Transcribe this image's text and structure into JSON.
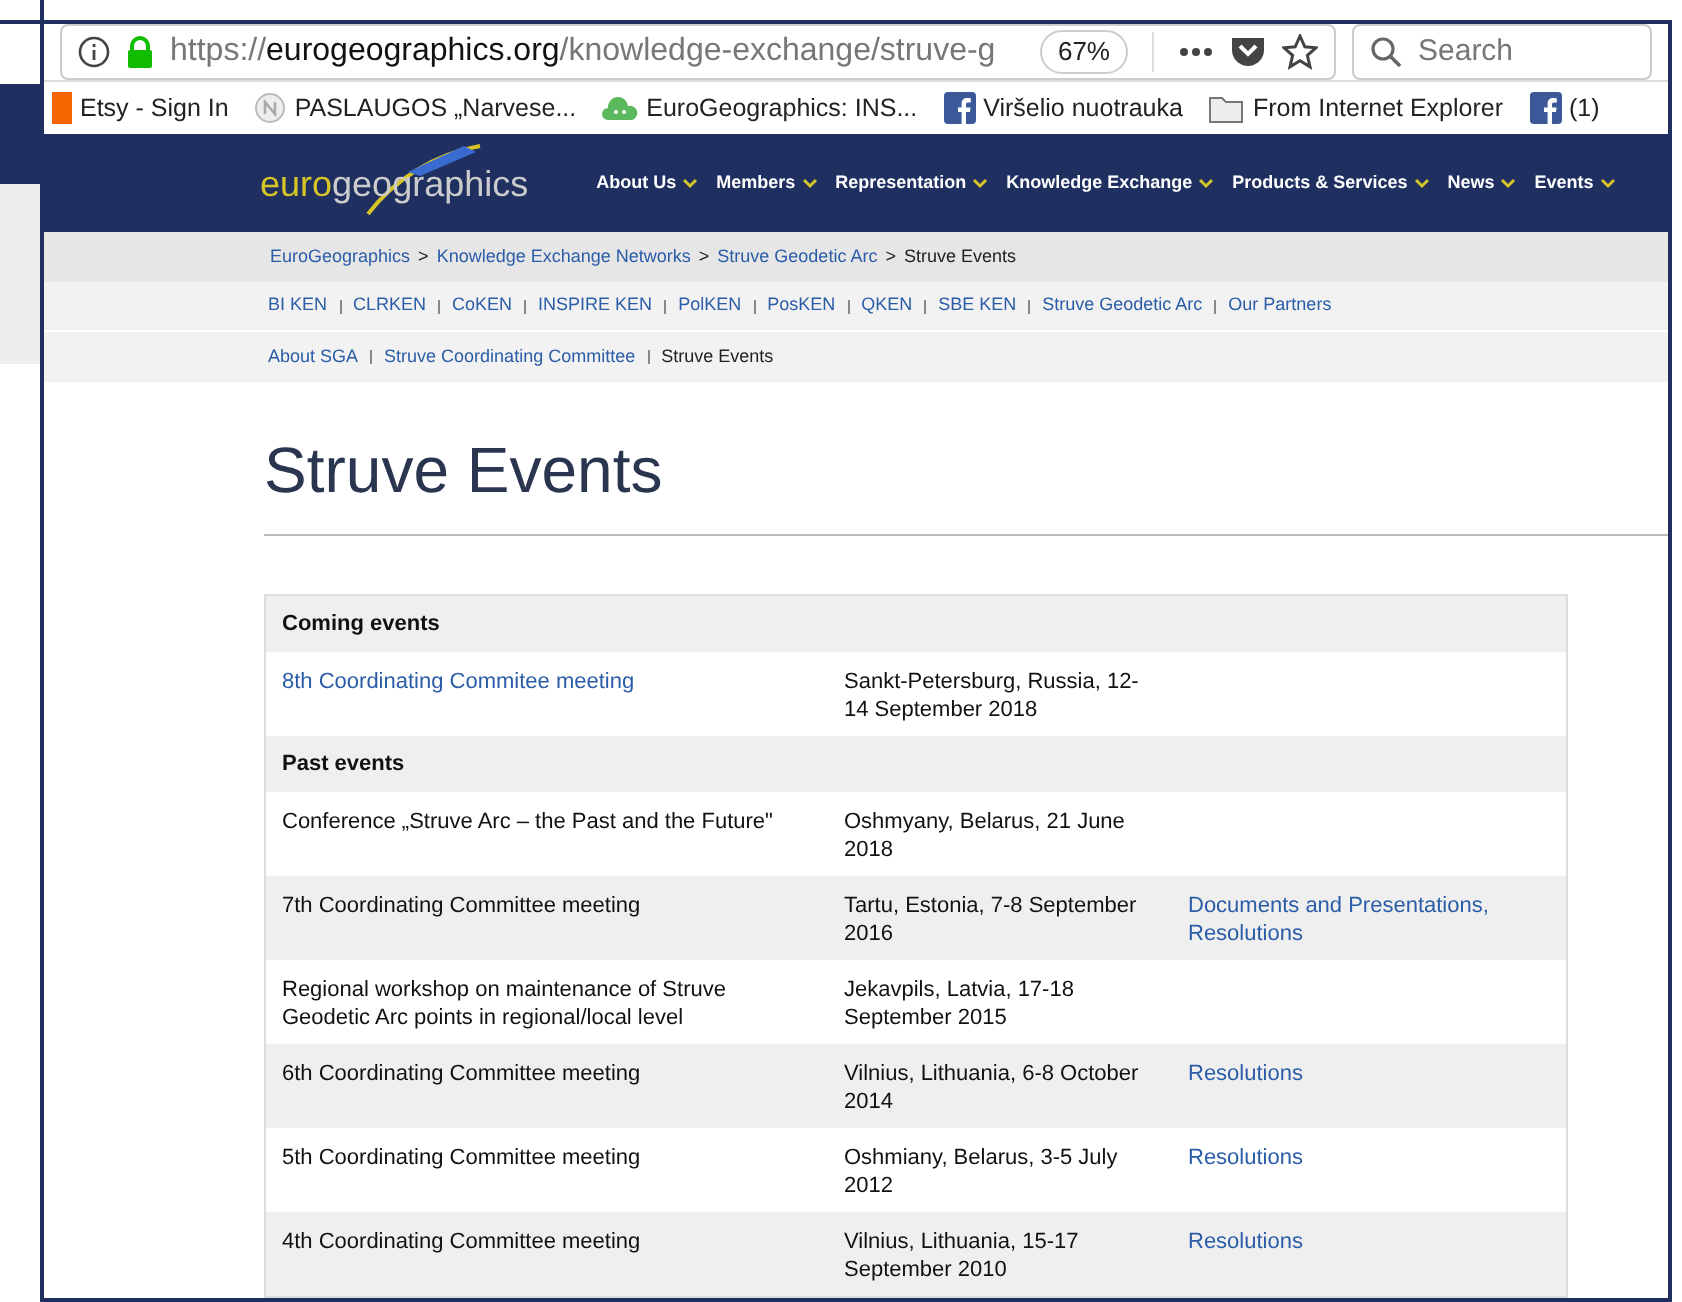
{
  "address_bar": {
    "url_host_prefix": "https://",
    "url_host": "eurogeographics.org",
    "url_path": "/knowledge-exchange/struve-g",
    "zoom": "67%",
    "search_placeholder": "Search"
  },
  "bookmarks": [
    {
      "label": "Etsy - Sign In",
      "kind": "etsy"
    },
    {
      "label": "PASLAUGOS „Narvese...",
      "kind": "circle"
    },
    {
      "label": "EuroGeographics: INS...",
      "kind": "cloud"
    },
    {
      "label": "Viršelio nuotrauka",
      "kind": "facebook"
    },
    {
      "label": "From Internet Explorer",
      "kind": "folder"
    },
    {
      "label": "(1)",
      "kind": "facebook"
    }
  ],
  "site": {
    "logo_prefix": "euro",
    "logo_suffix": "geographics",
    "menu": [
      "About Us",
      "Members",
      "Representation",
      "Knowledge Exchange",
      "Products & Services",
      "News",
      "Events"
    ],
    "breadcrumbs": [
      {
        "label": "EuroGeographics",
        "current": false
      },
      {
        "separator": ">",
        "label": "Knowledge Exchange Networks",
        "current": false
      },
      {
        "separator": ">",
        "label": "Struve Geodetic Arc",
        "current": false
      },
      {
        "separator": ">",
        "label": "Struve Events",
        "current": true
      }
    ],
    "subnav": [
      {
        "label": "BI KEN",
        "selected": false
      },
      {
        "label": "CLRKEN",
        "selected": false
      },
      {
        "label": "CoKEN",
        "selected": false
      },
      {
        "label": "INSPIRE KEN",
        "selected": false
      },
      {
        "label": "PolKEN",
        "selected": false
      },
      {
        "label": "PosKEN",
        "selected": false
      },
      {
        "label": "QKEN",
        "selected": false
      },
      {
        "label": "SBE KEN",
        "selected": false
      },
      {
        "label": "Struve Geodetic Arc",
        "selected": false
      },
      {
        "label": "Our Partners",
        "selected": false
      }
    ],
    "subnav2": [
      {
        "label": "About SGA",
        "selected": false
      },
      {
        "label": "Struve Coordinating Committee",
        "selected": false
      },
      {
        "label": "Struve Events",
        "selected": true
      }
    ],
    "heading": "Struve Events",
    "doc_separator": ", ",
    "rows": [
      {
        "kind": "header",
        "label": "Coming events"
      },
      {
        "kind": "event",
        "title": "8th Coordinating Commitee meeting",
        "link": true,
        "place": "Sankt-Petersburg, Russia, 12-14 September 2018",
        "docs": []
      },
      {
        "kind": "header",
        "label": "Past events"
      },
      {
        "kind": "event",
        "title": "Conference „Struve Arc – the Past and the Future\"",
        "link": false,
        "place": "Oshmyany, Belarus, 21 June 2018",
        "docs": []
      },
      {
        "kind": "event",
        "title": "7th Coordinating Committee meeting",
        "link": false,
        "place": "Tartu, Estonia, 7-8 September 2016",
        "docs": [
          "Documents and Presentations",
          "Resolutions"
        ]
      },
      {
        "kind": "event",
        "title": "Regional workshop on maintenance of Struve Geodetic Arc points in regional/local level",
        "link": false,
        "place": "Jekavpils, Latvia, 17-18 September 2015",
        "docs": []
      },
      {
        "kind": "event",
        "title": "6th Coordinating Committee meeting",
        "link": false,
        "place": "Vilnius, Lithuania, 6-8 October 2014",
        "docs": [
          "Resolutions"
        ]
      },
      {
        "kind": "event",
        "title": "5th Coordinating Committee meeting",
        "link": false,
        "place": "Oshmiany, Belarus, 3-5 July 2012",
        "docs": [
          "Resolutions"
        ]
      },
      {
        "kind": "event",
        "title": "4th Coordinating Committee meeting",
        "link": false,
        "place": "Vilnius, Lithuania, 15-17 September 2010",
        "docs": [
          "Resolutions"
        ]
      }
    ]
  }
}
